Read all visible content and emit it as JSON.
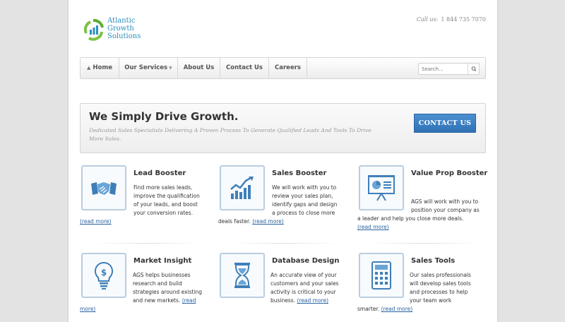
{
  "logo": {
    "line1": "Atlantic",
    "line2": "Growth",
    "line3": "Solutions"
  },
  "contact": {
    "label": "Call us:",
    "phone": "1 844 735 7070"
  },
  "nav": {
    "home": "Home",
    "services": "Our Services",
    "about": "About Us",
    "contact": "Contact Us",
    "careers": "Careers"
  },
  "search": {
    "placeholder": "Search..."
  },
  "hero": {
    "title": "We Simply Drive Growth.",
    "subtitle": "Dedicated Sales Specialists Delivering A Proven Process To Generate Qualified Leads And Tools To Drive More Sales.",
    "button": "CONTACT US"
  },
  "read_more": "(read more)",
  "services": [
    {
      "title": "Lead Booster",
      "icon": "handshake-icon",
      "lines": [
        "Find more sales leads,",
        "improve the qualification",
        "of your leads, and boost",
        "your conversion rates."
      ],
      "tail": ""
    },
    {
      "title": "Sales Booster",
      "icon": "growth-chart-icon",
      "lines": [
        "We will work with you to",
        "review your sales plan,",
        "identify gaps and design",
        "a process to close more"
      ],
      "tail": "deals faster."
    },
    {
      "title": "Value Prop Booster",
      "icon": "presentation-board-icon",
      "lines": [
        "AGS will work with you to",
        "position your company as",
        "a leader and help you close more deals."
      ],
      "tail": ""
    },
    {
      "title": "Market Insight",
      "icon": "lightbulb-icon",
      "lines": [
        "AGS helps businesses",
        "research and build",
        "strategies around existing",
        "and new markets."
      ],
      "tail": ""
    },
    {
      "title": "Database Design",
      "icon": "hourglass-icon",
      "lines": [
        "An accurate view of your",
        "customers and your sales",
        "activity is critical to your",
        "business."
      ],
      "tail": ""
    },
    {
      "title": "Sales Tools",
      "icon": "calculator-icon",
      "lines": [
        "Our sales professionals",
        "will develop sales tools",
        "and processes to help",
        "your team work"
      ],
      "tail": "smarter."
    }
  ]
}
